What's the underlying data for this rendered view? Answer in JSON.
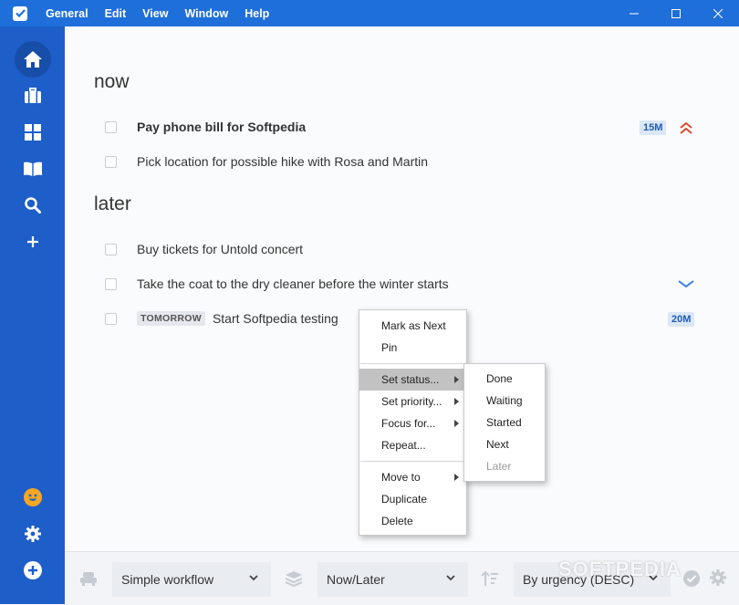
{
  "menu": {
    "items": [
      "General",
      "Edit",
      "View",
      "Window",
      "Help"
    ]
  },
  "sidebar": {
    "items": [
      {
        "icon": "home-icon",
        "active": true
      },
      {
        "icon": "briefcase-icon"
      },
      {
        "icon": "dashboard-icon"
      },
      {
        "icon": "book-icon"
      },
      {
        "icon": "search-icon"
      },
      {
        "icon": "plus-icon"
      }
    ],
    "bottom": [
      {
        "icon": "smiley-icon"
      },
      {
        "icon": "gear-icon"
      },
      {
        "icon": "add-circle-icon"
      }
    ]
  },
  "sections": [
    {
      "title": "now",
      "tasks": [
        {
          "text": "Pay phone bill for Softpedia",
          "bold": true,
          "duration": "15M",
          "priority": "high"
        },
        {
          "text": "Pick location for possible hike with Rosa and Martin"
        }
      ]
    },
    {
      "title": "later",
      "tasks": [
        {
          "text": "Buy tickets for Untold concert"
        },
        {
          "text": "Take the coat to the dry cleaner before the winter starts",
          "priority": "low"
        },
        {
          "text": "Start Softpedia testing",
          "tag": "TOMORROW",
          "duration": "20M"
        }
      ]
    }
  ],
  "context_menu": {
    "items": [
      "Mark as Next",
      "Pin",
      "Set status...",
      "Set priority...",
      "Focus for...",
      "Repeat...",
      "Move to",
      "Duplicate",
      "Delete"
    ],
    "submenu": [
      "Done",
      "Waiting",
      "Started",
      "Next",
      "Later"
    ]
  },
  "toolbar": {
    "workflow": "Simple workflow",
    "grouping": "Now/Later",
    "sort": "By urgency (DESC)"
  },
  "watermark": "SOFTPEDIA",
  "colors": {
    "titlebar": "#1e6fd9",
    "sidebar": "#1d5ec9",
    "accent": "#3a7fe0",
    "priority_high": "#d9482b",
    "smiley": "#f5a623"
  }
}
